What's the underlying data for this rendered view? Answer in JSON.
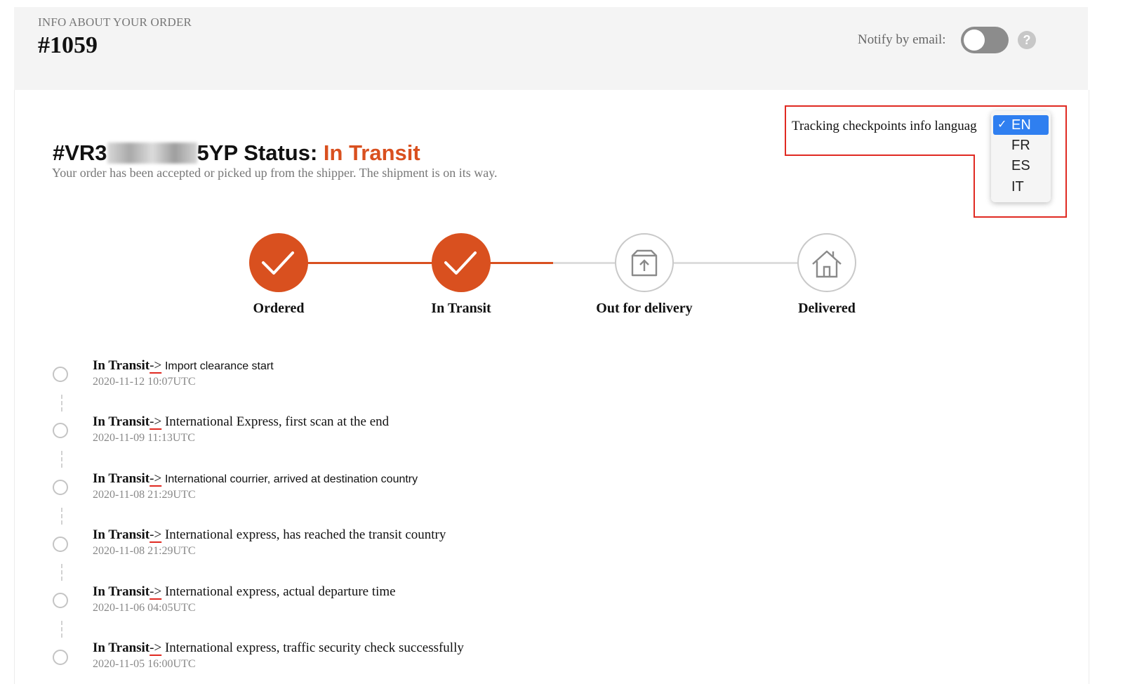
{
  "header": {
    "eyebrow": "INFO ABOUT YOUR ORDER",
    "order_number": "#1059",
    "notify_label": "Notify by email:",
    "notify_enabled": false,
    "help_icon": "question-circle-icon",
    "help_glyph": "?"
  },
  "status": {
    "tracking_prefix": "#VR3",
    "tracking_suffix": "5YP",
    "label": "Status:",
    "value": "In Transit",
    "description": "Your order has been accepted or picked up from the shipper. The shipment is on its way."
  },
  "language": {
    "label": "Tracking checkpoints info languag",
    "options": [
      "EN",
      "FR",
      "ES",
      "IT"
    ],
    "selected": "EN",
    "check_glyph": "✓"
  },
  "steps": [
    {
      "label": "Ordered",
      "state": "done",
      "icon": "checkmark-icon"
    },
    {
      "label": "In Transit",
      "state": "done",
      "icon": "checkmark-icon"
    },
    {
      "label": "Out for delivery",
      "state": "pending",
      "icon": "package-icon"
    },
    {
      "label": "Delivered",
      "state": "pending",
      "icon": "house-icon"
    }
  ],
  "events": [
    {
      "status": "In Transit",
      "arrow": "->",
      "desc": "Import clearance start",
      "time": "2020-11-12 10:07UTC"
    },
    {
      "status": "In Transit",
      "arrow": "->",
      "desc": "International Express, first scan at the end",
      "time": "2020-11-09 11:13UTC"
    },
    {
      "status": "In Transit",
      "arrow": "->",
      "desc": "International courrier, arrived at destination country",
      "time": "2020-11-08 21:29UTC"
    },
    {
      "status": "In Transit",
      "arrow": "->",
      "desc": "International express, has reached the transit country",
      "time": "2020-11-08 21:29UTC"
    },
    {
      "status": "In Transit",
      "arrow": "->",
      "desc": "International express, actual departure time",
      "time": "2020-11-06 04:05UTC"
    },
    {
      "status": "In Transit",
      "arrow": "->",
      "desc": "International express, traffic security check successfully",
      "time": "2020-11-05 16:00UTC"
    }
  ],
  "colors": {
    "accent": "#d9501f",
    "highlight": "#e02a22",
    "selected": "#2f7ff0"
  }
}
